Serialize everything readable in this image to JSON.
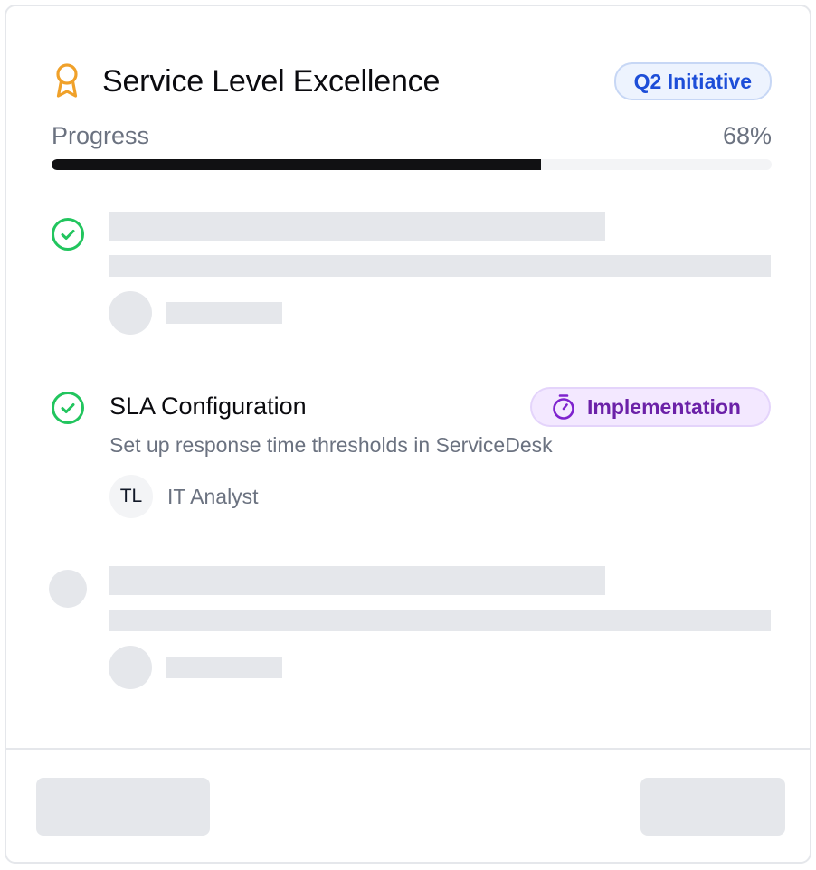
{
  "header": {
    "icon": "award-icon",
    "title": "Service Level Excellence",
    "badge": "Q2 Initiative"
  },
  "progress": {
    "label": "Progress",
    "value_text": "68%",
    "value": 0.68
  },
  "tasks": [
    {
      "state": "loading",
      "completed": true,
      "status_icon": "check-circle-icon"
    },
    {
      "state": "loaded",
      "completed": true,
      "status_icon": "check-circle-icon",
      "title": "SLA Configuration",
      "stage_icon": "timer-icon",
      "stage": "Implementation",
      "description": "Set up response time thresholds in ServiceDesk",
      "assignee_initials": "TL",
      "assignee": "IT Analyst"
    },
    {
      "state": "loading",
      "completed": false
    }
  ],
  "footer": {
    "state": "loading"
  },
  "colors": {
    "accent_gold": "#f59e0b",
    "success_green": "#22c55e",
    "badge_blue": "#1d4ed8",
    "badge_purple": "#7e22ce",
    "progress_fill": "#111113",
    "skeleton": "#e5e7eb"
  }
}
